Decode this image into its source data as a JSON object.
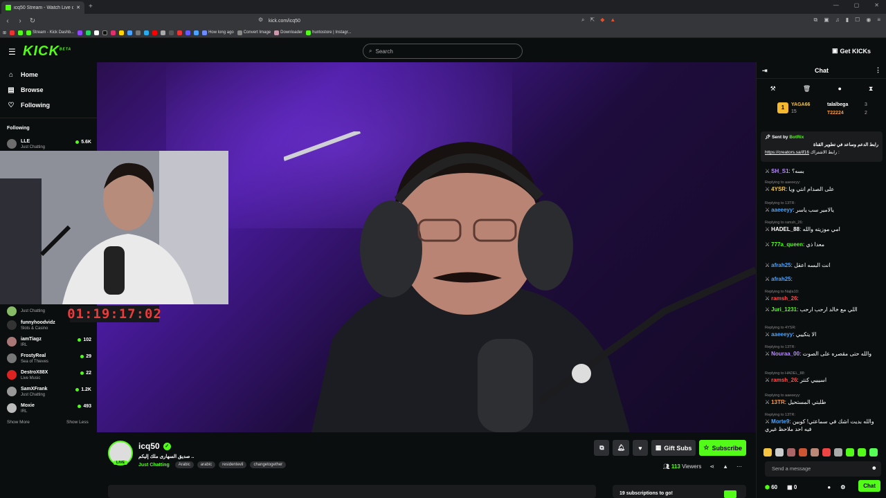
{
  "browser": {
    "tab_title": "icq50 Stream - Watch Live on Ki",
    "new_tab": "+",
    "url": "kick.com/icq50",
    "bookmarks": [
      "Stream - Kick Dashb...",
      "How long ago",
      "Convert Image",
      "Downloader",
      "huntostore | Instagr..."
    ]
  },
  "header": {
    "logo": "KICK",
    "logo_sup": "BETA",
    "search_placeholder": "Search",
    "get_kicks": "Get KICKs"
  },
  "sidebar": {
    "nav": [
      {
        "label": "Home",
        "icon": "home-icon"
      },
      {
        "label": "Browse",
        "icon": "browse-icon"
      },
      {
        "label": "Following",
        "icon": "heart-icon"
      }
    ],
    "following_title": "Following",
    "channels": [
      {
        "name": "LLE",
        "category": "Just Chatting",
        "viewers": "5.6K"
      },
      {
        "name": "",
        "category": "Just Chatting",
        "viewers": ""
      },
      {
        "name": "funnyhoodvidz",
        "category": "Slots & Casino",
        "viewers": ""
      },
      {
        "name": "iamTiagz",
        "category": "IRL",
        "viewers": "102"
      },
      {
        "name": "FrostyReal",
        "category": "Sea of Thieves",
        "viewers": "29"
      },
      {
        "name": "DestroX88X",
        "category": "Live Music",
        "viewers": "22"
      },
      {
        "name": "SamXFrank",
        "category": "Just Chatting",
        "viewers": "1.2K"
      },
      {
        "name": "Moxie",
        "category": "IRL",
        "viewers": "493"
      }
    ],
    "show_more": "Show More",
    "show_less": "Show Less"
  },
  "stream": {
    "timer": "01:19:17:02",
    "channel": "icq50",
    "live": "LIVE",
    "title": "صديق السهارى ملك إليكم ..",
    "category": "Just Chatting",
    "tags": [
      "Arabic",
      "arabic",
      "residentevil",
      "changetogether"
    ],
    "gift_subs": "Gift Subs",
    "subscribe": "Subscribe",
    "viewers_count": "113",
    "viewers_label": "Viewers",
    "sub_goal": "19 subscriptions to go!"
  },
  "chat": {
    "title": "Chat",
    "leaderboard": [
      {
        "name": "YAGA66",
        "value": "15"
      },
      {
        "name": "talalbega",
        "value": "3"
      },
      {
        "name": "T22224",
        "value": "2"
      }
    ],
    "pinned_sent_by": "Sent by",
    "pinned_bot": "BotRix",
    "pinned_text": "رابط الدعم وساعد في تطوير القناة",
    "pinned_link": "https://creators.sa/if16",
    "pinned_link_label": "رابط الاشتراك :",
    "messages": [
      {
        "reply": "",
        "user": "SH_S1",
        "color": "#b98cff",
        "text": "بسه؟"
      },
      {
        "reply": "Replying to aaeeeyy:",
        "user": "4YSR",
        "color": "#f5c542",
        "text": "على الصدام انتي ويا"
      },
      {
        "reply": "Replying to 13TR:",
        "user": "aaeeeyy",
        "color": "#4aa3ff",
        "text": "يالامير سب ياسر"
      },
      {
        "reply": "Replying to ramsh_26:",
        "user": "HADEL_88",
        "color": "#ffffff",
        "text": "امي موزيته والله"
      },
      {
        "reply": "",
        "user": "777a_queen",
        "color": "#53fc18",
        "text": "معدا ذي"
      },
      {
        "reply": "",
        "user": "afrah25",
        "color": "#4aa3ff",
        "text": "انت البسه اعقل"
      },
      {
        "reply": "",
        "user": "afrah25",
        "color": "#4aa3ff",
        "text": ""
      },
      {
        "reply": "Replying to Najla10:",
        "user": "ramsh_26",
        "color": "#ff4d4d",
        "text": ""
      },
      {
        "reply": "",
        "user": "Juri_1231",
        "color": "#53fc18",
        "text": "اللي مع خالد ارحب ارحب"
      },
      {
        "reply": "Replying to 4YSR:",
        "user": "aaeeeyy",
        "color": "#4aa3ff",
        "text": "الا يتكييي"
      },
      {
        "reply": "Replying to 13TR:",
        "user": "Nouraa_00",
        "color": "#b98cff",
        "text": "والله حتى مقصره على الصوت"
      },
      {
        "reply": "Replying to HADEL_88:",
        "user": "ramsh_26",
        "color": "#ff4d4d",
        "text": "اسيييي كنتر"
      },
      {
        "reply": "Replying to aaeeeyy:",
        "user": "13TR",
        "color": "#ff9a3c",
        "text": "طلبتي المستحيل"
      },
      {
        "reply": "Replying to 13TR:",
        "user": "Morte9",
        "color": "#4aa3ff",
        "text": "والله بديت اشك في سماعتي! كوبين فيه احد ملاحظ غيري"
      }
    ],
    "input_placeholder": "Send a message",
    "kicks": "60",
    "gifts": "0",
    "chat_button": "Chat"
  }
}
